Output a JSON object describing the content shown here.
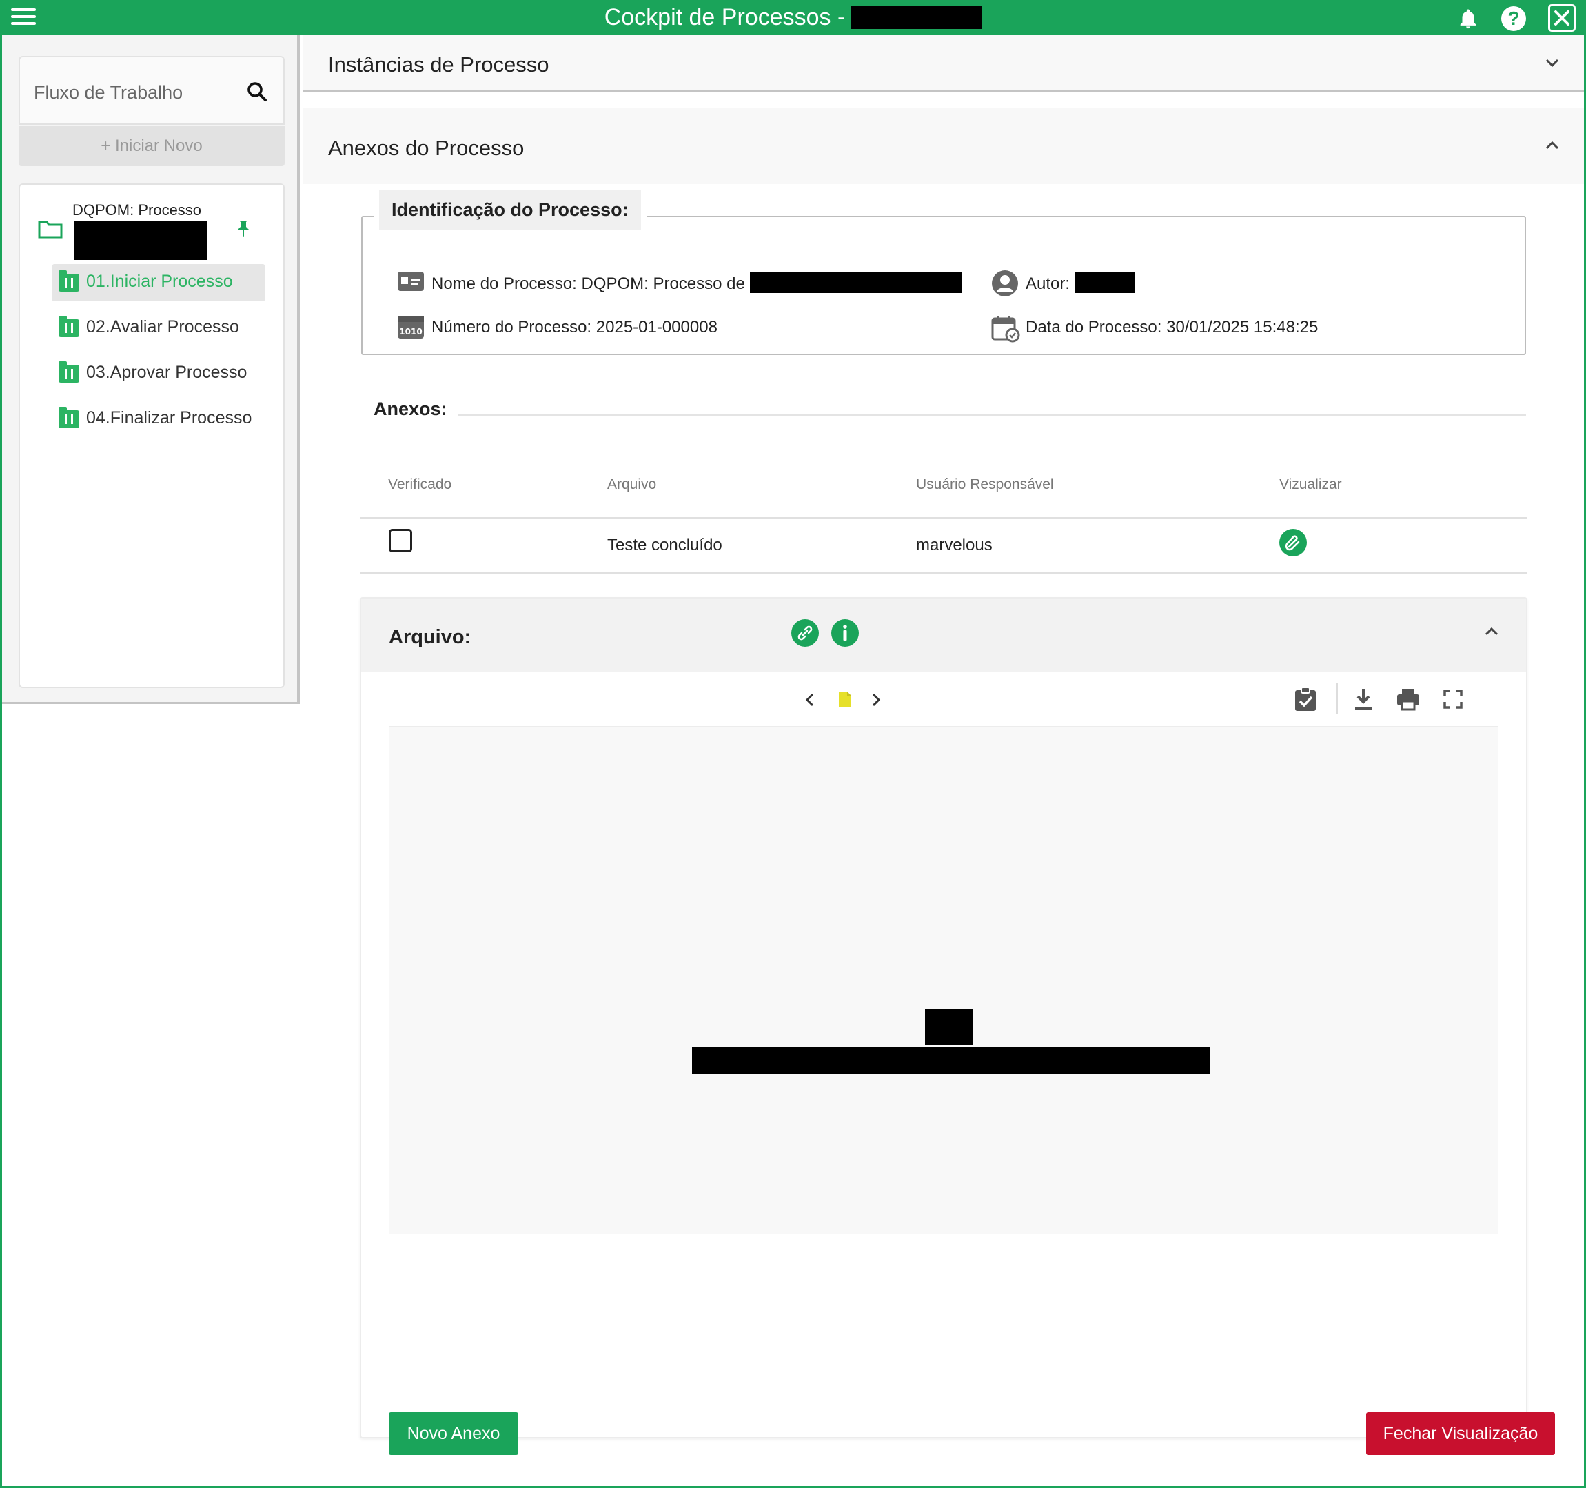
{
  "app": {
    "title": "Cockpit de Processos -",
    "colors": {
      "primary": "#1aa45a",
      "danger": "#c8102e"
    }
  },
  "icons": [
    "menu-icon",
    "bell-icon",
    "help-icon",
    "close-icon",
    "search-icon",
    "folder-icon",
    "pin-icon",
    "workflow-step-icon",
    "chevron-down-icon",
    "chevron-up-icon",
    "id-card-icon",
    "number-icon",
    "user-icon",
    "calendar-icon",
    "paperclip-icon",
    "link-icon",
    "info-icon",
    "chevron-left-icon",
    "document-icon",
    "chevron-right-icon",
    "clipboard-check-icon",
    "download-icon",
    "print-icon",
    "fullscreen-icon"
  ],
  "sidebar": {
    "search_placeholder": "Fluxo de Trabalho",
    "start_new": "+ Iniciar Novo",
    "process_label": "DQPOM: Processo",
    "steps": [
      {
        "label": "01.Iniciar Processo",
        "active": true
      },
      {
        "label": "02.Avaliar Processo",
        "active": false
      },
      {
        "label": "03.Aprovar Processo",
        "active": false
      },
      {
        "label": "04.Finalizar Processo",
        "active": false
      }
    ]
  },
  "main": {
    "instances_title": "Instâncias de Processo",
    "attachments_title": "Anexos do Processo",
    "identification": {
      "title": "Identificação do Processo:",
      "name_label": "Nome do Processo:",
      "name_value": "DQPOM: Processo de",
      "author_label": "Autor:",
      "number_label": "Número do Processo:",
      "number_value": "2025-01-000008",
      "date_label": "Data do Processo:",
      "date_value": "30/01/2025 15:48:25"
    },
    "anexos_label": "Anexos:",
    "table": {
      "headers": [
        "Verificado",
        "Arquivo",
        "Usuário Responsável",
        "Vizualizar"
      ],
      "rows": [
        {
          "verificado": false,
          "arquivo": "Teste concluído",
          "usuario": "marvelous"
        }
      ]
    },
    "viewer": {
      "title": "Arquivo:",
      "new_attachment": "Novo Anexo",
      "close_view": "Fechar Visualização"
    }
  }
}
